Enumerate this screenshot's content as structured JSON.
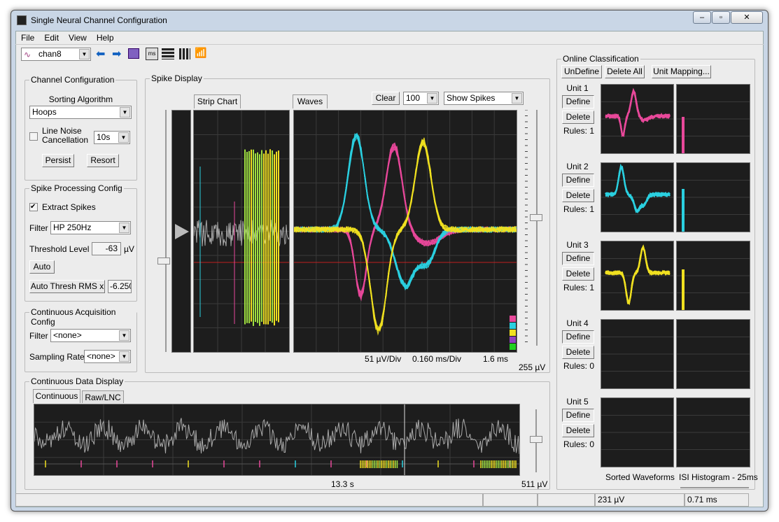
{
  "window": {
    "title": "Single Neural Channel Configuration",
    "minimize": "–",
    "maximize": "▫",
    "close": "✕"
  },
  "menu": [
    "File",
    "Edit",
    "View",
    "Help"
  ],
  "toolbar": {
    "channel": "chan8",
    "back_icon": "arrow-left-icon",
    "forward_icon": "arrow-right-icon",
    "ms_label": "ms"
  },
  "channel_config": {
    "title": "Channel Configuration",
    "sorting_label": "Sorting Algorithm",
    "sorting_value": "Hoops",
    "line_noise_label1": "Line Noise",
    "line_noise_label2": "Cancellation",
    "line_noise_checked": false,
    "line_noise_value": "10s",
    "persist": "Persist",
    "resort": "Resort"
  },
  "spike_config": {
    "title": "Spike Processing Config",
    "extract_label": "Extract Spikes",
    "extract_checked": true,
    "filter_label": "Filter",
    "filter_value": "HP 250Hz",
    "threshold_label": "Threshold Level",
    "threshold_value": "-63",
    "threshold_unit": "µV",
    "auto": "Auto",
    "auto_thresh": "Auto Thresh RMS x",
    "rms_value": "-6.250"
  },
  "cont_config": {
    "title": "Continuous Acquisition Config",
    "filter_label": "Filter",
    "filter_value": "<none>",
    "rate_label": "Sampling Rate",
    "rate_value": "<none>"
  },
  "spike_display": {
    "title": "Spike Display",
    "tab_strip": "Strip Chart",
    "tab_waves": "Waves",
    "clear": "Clear",
    "count": "100",
    "mode": "Show Spikes",
    "volts_div": "51 µV/Div",
    "time_div": "0.160 ms/Div",
    "duration": "1.6 ms",
    "scale": "255 µV"
  },
  "continuous_display": {
    "title": "Continuous Data Display",
    "tab_continuous": "Continuous",
    "tab_raw": "Raw/LNC",
    "time": "13.3 s",
    "scale": "511 µV"
  },
  "classification": {
    "title": "Online Classification",
    "undefine": "UnDefine",
    "delete_all": "Delete All",
    "unit_mapping": "Unit Mapping...",
    "sorted_label": "Sorted Waveforms",
    "isi_label": "ISI Histogram - 25ms",
    "units": [
      {
        "name": "Unit 1",
        "define": "Define",
        "delete": "Delete",
        "rules": "Rules: 1",
        "color": "#e8489a"
      },
      {
        "name": "Unit 2",
        "define": "Define",
        "delete": "Delete",
        "rules": "Rules: 1",
        "color": "#2ad0e0"
      },
      {
        "name": "Unit 3",
        "define": "Define",
        "delete": "Delete",
        "rules": "Rules: 1",
        "color": "#f0e020"
      },
      {
        "name": "Unit 4",
        "define": "Define",
        "delete": "Delete",
        "rules": "Rules: 0",
        "color": ""
      },
      {
        "name": "Unit 5",
        "define": "Define",
        "delete": "Delete",
        "rules": "Rules: 0",
        "color": ""
      }
    ]
  },
  "status": {
    "voltage": "231 µV",
    "time": "0.71 ms"
  },
  "colors": {
    "unit_legend": [
      "#e8489a",
      "#2ad0e0",
      "#f0e020",
      "#9040c0",
      "#20d020"
    ],
    "threshold": "#c02020",
    "strip_green": "#a0e040"
  }
}
